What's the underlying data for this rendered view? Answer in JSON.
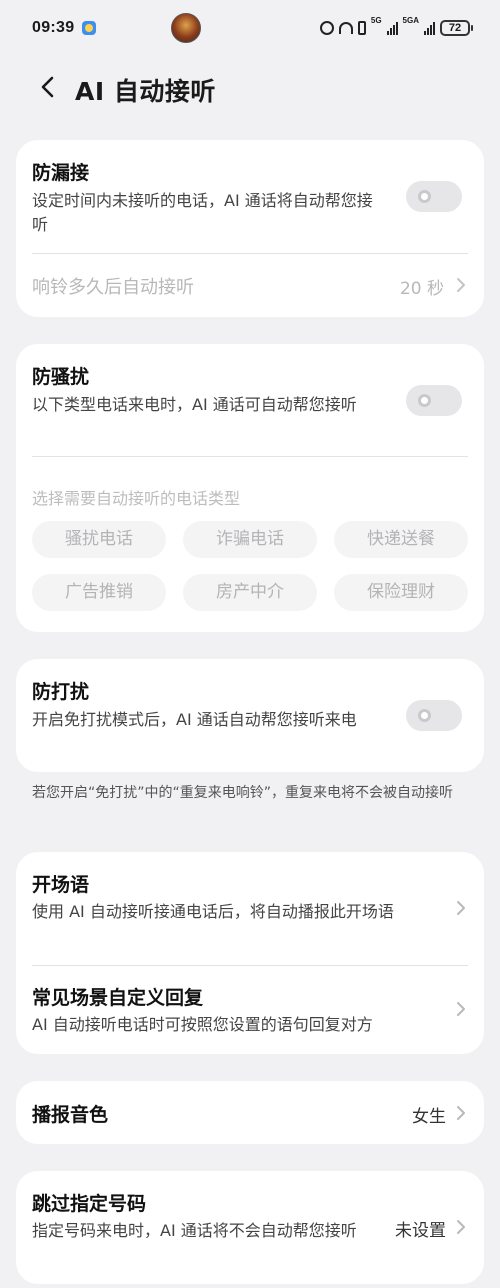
{
  "status_bar": {
    "time": "09:39",
    "net1": "5G",
    "net2": "5GA",
    "battery": "72"
  },
  "header": {
    "title": "AI 自动接听"
  },
  "missed_call": {
    "title": "防漏接",
    "desc": "设定时间内未接听的电话，AI 通话将自动帮您接听",
    "ring_label": "响铃多久后自动接听",
    "ring_value": "20 秒"
  },
  "anti_harass": {
    "title": "防骚扰",
    "desc": "以下类型电话来电时，AI 通话可自动帮您接听",
    "choose_label": "选择需要自动接听的电话类型",
    "chips": [
      "骚扰电话",
      "诈骗电话",
      "快递送餐",
      "广告推销",
      "房产中介",
      "保险理财"
    ]
  },
  "dnd": {
    "title": "防打扰",
    "desc": "开启免打扰模式后，AI 通话自动帮您接听来电",
    "note": "若您开启“免打扰”中的“重复来电响铃”，重复来电将不会被自动接听"
  },
  "greeting": {
    "title": "开场语",
    "desc": "使用 AI 自动接听接通电话后，将自动播报此开场语"
  },
  "custom_reply": {
    "title": "常见场景自定义回复",
    "desc": "AI 自动接听电话时可按照您设置的语句回复对方"
  },
  "voice": {
    "title": "播报音色",
    "value": "女生"
  },
  "skip_numbers": {
    "title": "跳过指定号码",
    "desc": "指定号码来电时，AI 通话将不会自动帮您接听",
    "value": "未设置"
  }
}
